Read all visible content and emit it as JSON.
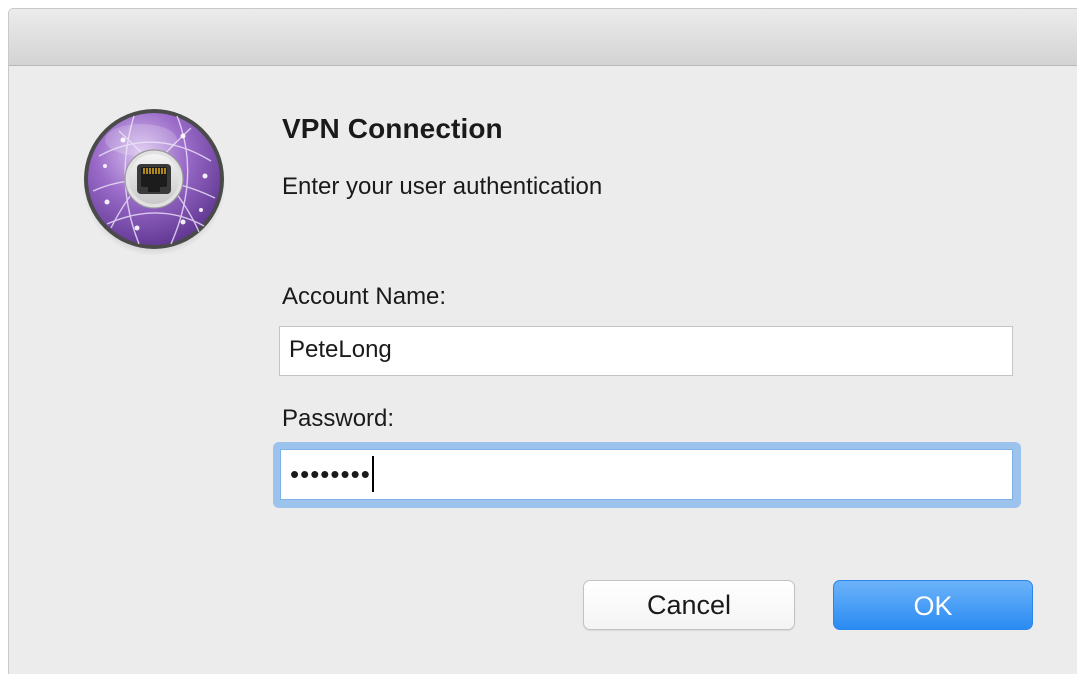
{
  "dialog": {
    "title": "VPN Connection",
    "message": "Enter your user authentication",
    "icon": "network-globe-ethernet-icon"
  },
  "form": {
    "account_label": "Account Name:",
    "account_value": "PeteLong",
    "password_label": "Password:",
    "password_masked": "••••••••"
  },
  "buttons": {
    "cancel_label": "Cancel",
    "ok_label": "OK"
  },
  "colors": {
    "accent": "#2a8bf2",
    "focus_ring": "#9cc2ee",
    "icon_purple": "#8a5cb8"
  }
}
